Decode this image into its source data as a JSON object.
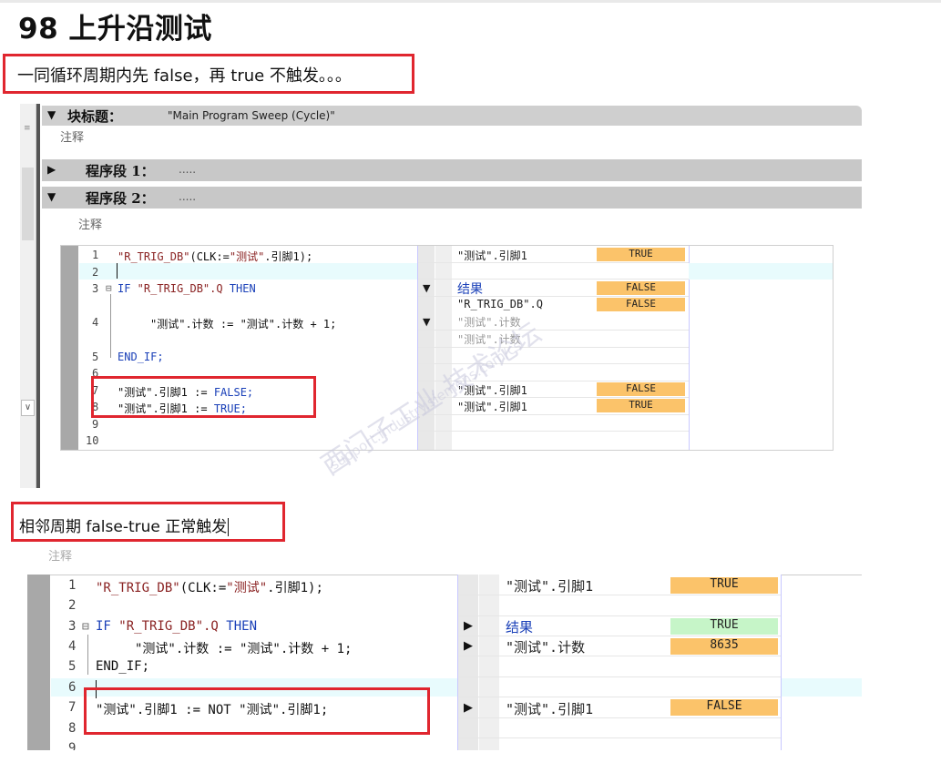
{
  "page_title": "98 上升沿测试",
  "note1": "一同循环周期内先 false，再 true 不触发。。。",
  "note2": "相邻周期 false-true 正常触发",
  "shot1": {
    "block_title_label": "块标题：",
    "block_title_value": "\"Main Program Sweep (Cycle)\"",
    "comment": "注释",
    "segment1_label": "程序段 1：",
    "segment1_dots": ".....",
    "segment2_label": "程序段 2：",
    "segment2_dots": ".....",
    "segment2_comment": "注释",
    "line_numbers": [
      "1",
      "2",
      "3",
      "4",
      "5",
      "6",
      "7",
      "8",
      "9",
      "10"
    ],
    "code": {
      "l1a": "\"R_TRIG_DB\"",
      "l1b": "(CLK:=",
      "l1c": "\"测试\"",
      "l1d": ".引脚1);",
      "l3_if": "IF",
      "l3_var": " \"R_TRIG_DB\".Q ",
      "l3_then": "THEN",
      "l4": "\"测试\".计数 := \"测试\".计数 + 1;",
      "l5": "END_IF;",
      "l7a": "\"测试\".引脚1 := ",
      "l7b": "FALSE;",
      "l8a": "\"测试\".引脚1 := ",
      "l8b": "TRUE;"
    },
    "monitor": {
      "r1_label": "\"测试\".引脚1",
      "r1_value": "TRUE",
      "r3_label": "结果",
      "r3_value": "FALSE",
      "r3b_label": "\"R_TRIG_DB\".Q",
      "r3b_value": "FALSE",
      "r4_label": "\"测试\".计数",
      "r4b_label": "\"测试\".计数",
      "r7_label": "\"测试\".引脚1",
      "r7_value": "FALSE",
      "r8_label": "\"测试\".引脚1",
      "r8_value": "TRUE"
    },
    "watermark_cn": "西门子工业 技术论坛",
    "watermark_en": "support.industry.siemens.com/cs"
  },
  "shot2": {
    "hidden_comment": "注释",
    "line_numbers": [
      "1",
      "2",
      "3",
      "4",
      "5",
      "6",
      "7",
      "8",
      "9"
    ],
    "code": {
      "l1a": "\"R_TRIG_DB\"",
      "l1b": "(CLK:=",
      "l1c": "\"测试\"",
      "l1d": ".引脚1);",
      "l3_if": "IF",
      "l3_var": " \"R_TRIG_DB\".Q ",
      "l3_then": "THEN",
      "l4": "\"测试\".计数 := \"测试\".计数 + 1;",
      "l5": "END_IF;",
      "l7": "\"测试\".引脚1 := NOT \"测试\".引脚1;"
    },
    "monitor": {
      "r1_label": "\"测试\".引脚1",
      "r1_value": "TRUE",
      "r3_label": "结果",
      "r3_value": "TRUE",
      "r4_label": "\"测试\".计数",
      "r4_value": "8635",
      "r7_label": "\"测试\".引脚1",
      "r7_value": "FALSE"
    }
  },
  "colors": {
    "annotation_red": "#e0262f",
    "monitor_orange": "#fbc36a",
    "monitor_green": "#c6f5c8",
    "keyword_blue": "#1a40b8"
  }
}
